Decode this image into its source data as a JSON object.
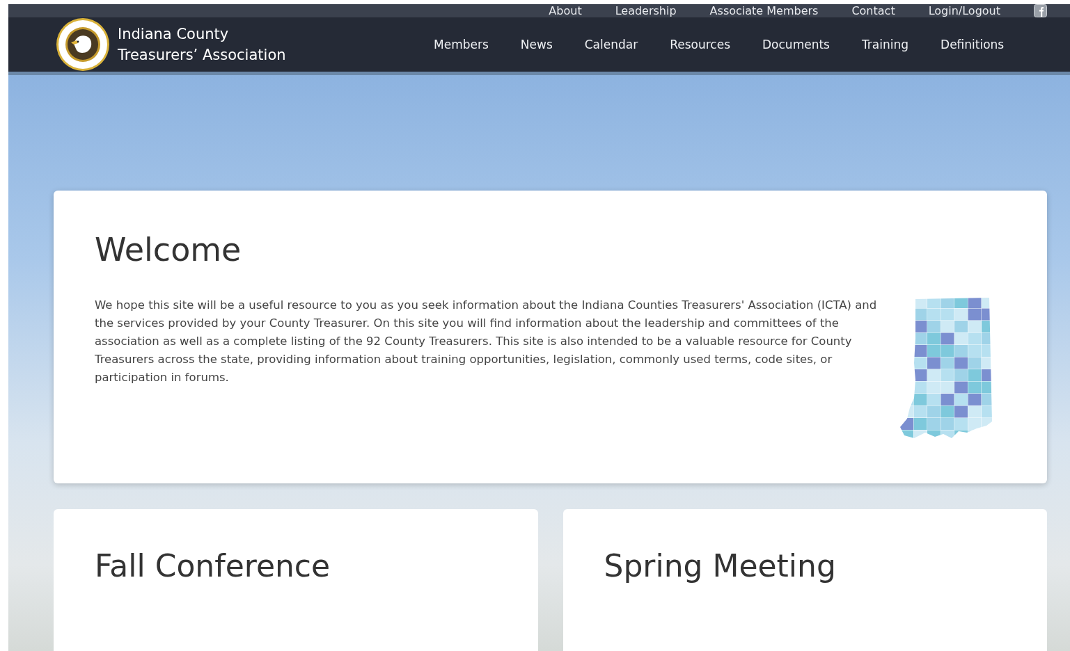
{
  "top_bar": {
    "links": [
      {
        "label": "About"
      },
      {
        "label": "Leadership"
      },
      {
        "label": "Associate Members"
      },
      {
        "label": "Contact"
      },
      {
        "label": "Login/Logout"
      }
    ]
  },
  "header": {
    "site_title": [
      "Indiana County",
      "Treasurers’ Association"
    ],
    "nav": [
      {
        "label": "Members"
      },
      {
        "label": "News"
      },
      {
        "label": "Calendar"
      },
      {
        "label": "Resources"
      },
      {
        "label": "Documents"
      },
      {
        "label": "Training"
      },
      {
        "label": "Definitions"
      }
    ]
  },
  "welcome": {
    "heading": "Welcome",
    "text": "We hope this site will be a useful resource to you as you seek information about the Indiana Counties Treasurers' Association (ICTA) and the services provided by your County Treasurer. On this site you will find information about the leadership and committees of the association as well as a complete listing of the 92 County Treasurers. This site is also intended to be a valuable resource for County Treasurers across the state, providing information about training opportunities, legislation, commonly used terms, code sites, or participation in forums."
  },
  "cards": [
    {
      "heading": "Fall Conference"
    },
    {
      "heading": "Spring Meeting"
    }
  ]
}
